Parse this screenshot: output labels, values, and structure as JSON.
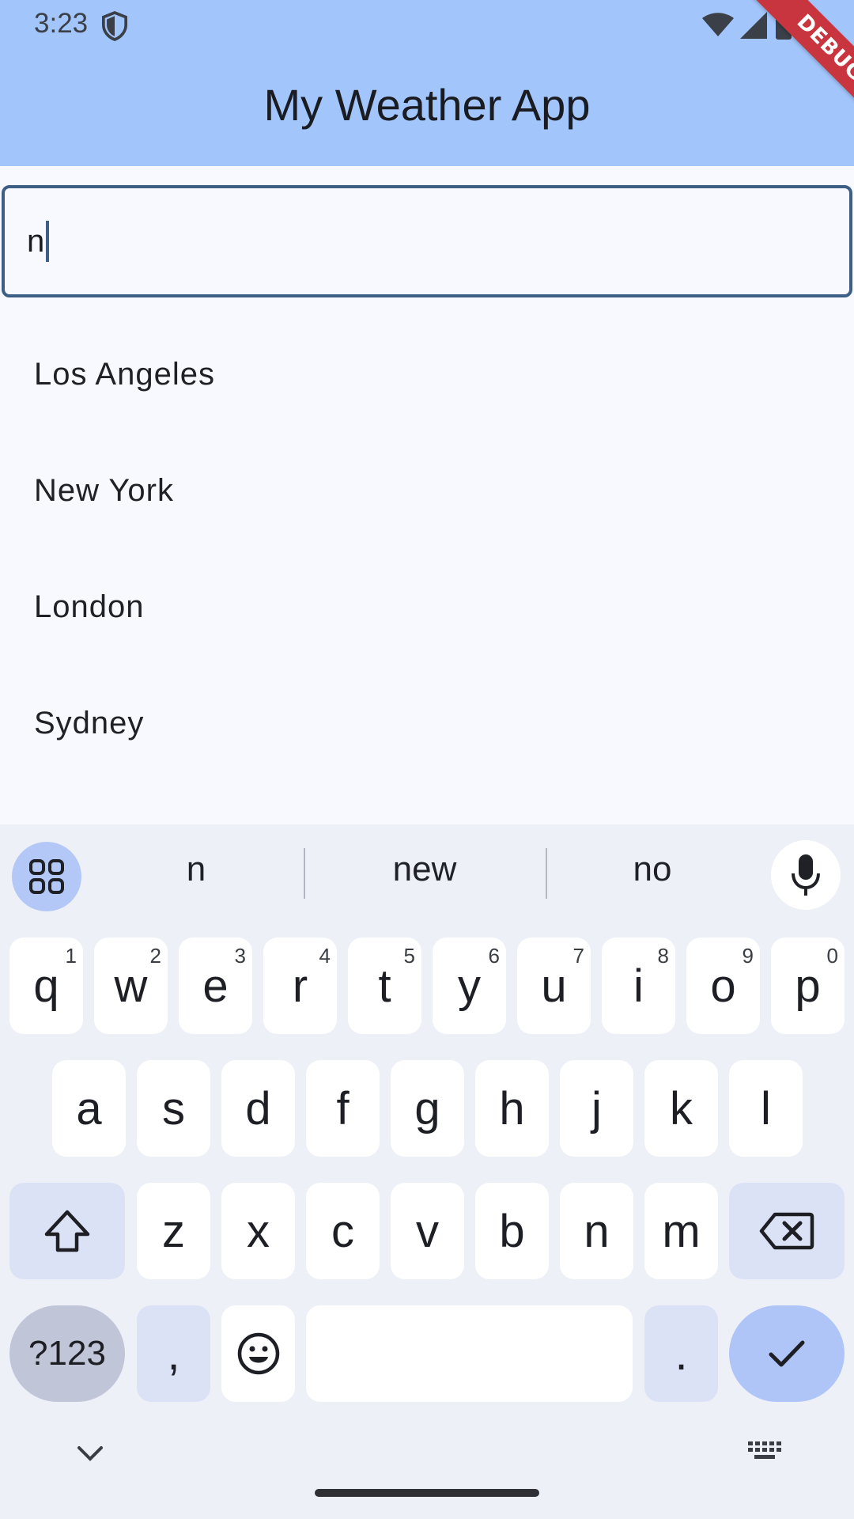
{
  "status_bar": {
    "time": "3:23"
  },
  "app_bar": {
    "title": "My Weather App",
    "debug_label": "DEBUG"
  },
  "search": {
    "value": "n"
  },
  "cities": [
    "Los Angeles",
    "New York",
    "London",
    "Sydney"
  ],
  "keyboard": {
    "suggestions": [
      "n",
      "new",
      "no"
    ],
    "row1": [
      {
        "k": "q",
        "h": "1"
      },
      {
        "k": "w",
        "h": "2"
      },
      {
        "k": "e",
        "h": "3"
      },
      {
        "k": "r",
        "h": "4"
      },
      {
        "k": "t",
        "h": "5"
      },
      {
        "k": "y",
        "h": "6"
      },
      {
        "k": "u",
        "h": "7"
      },
      {
        "k": "i",
        "h": "8"
      },
      {
        "k": "o",
        "h": "9"
      },
      {
        "k": "p",
        "h": "0"
      }
    ],
    "row2": [
      "a",
      "s",
      "d",
      "f",
      "g",
      "h",
      "j",
      "k",
      "l"
    ],
    "row3": [
      "z",
      "x",
      "c",
      "v",
      "b",
      "n",
      "m"
    ],
    "symbols_label": "?123",
    "comma_label": ",",
    "period_label": "."
  },
  "colors": {
    "app_bar": "#a2c6fb",
    "field_border": "#3e5f85",
    "enter_key": "#afc4f7"
  }
}
